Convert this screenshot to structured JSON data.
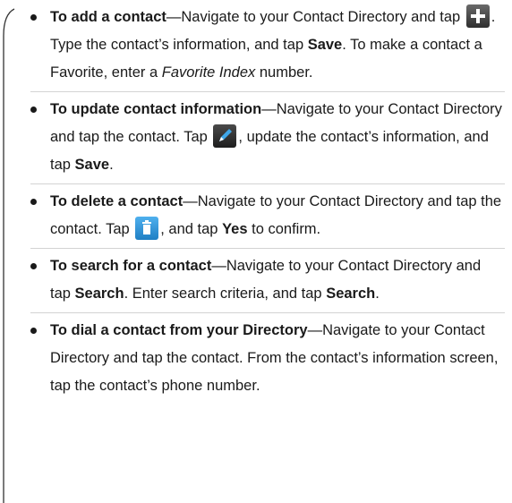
{
  "items": [
    {
      "lead": "To add a contact",
      "dash": "—",
      "pre": "Navigate to your Contact Directory and tap ",
      "icon": "add-icon",
      "mid": ". Type the contact’s information, and tap ",
      "b1": "Save",
      "post": ". To make a contact a Favorite, enter a ",
      "italic": "Favorite Index",
      "end": " number."
    },
    {
      "lead": "To update contact information",
      "dash": "—",
      "pre": "Navigate to your Contact Directory and tap the contact. Tap ",
      "icon": "edit-icon",
      "mid": ", update the contact’s information, and tap ",
      "b1": "Save",
      "end": "."
    },
    {
      "lead": "To delete a contact",
      "dash": "—",
      "pre": "Navigate to your Contact Directory and tap the contact. Tap ",
      "icon": "trash-icon",
      "mid": ", and tap ",
      "b1": "Yes",
      "end": " to confirm."
    },
    {
      "lead": "To search for a contact",
      "dash": "—",
      "pre": "Navigate to your Contact Directory and tap ",
      "b1": "Search",
      "mid": ". Enter search criteria, and tap ",
      "b2": "Search",
      "end": "."
    },
    {
      "lead": "To dial a contact from your Directory",
      "dash": "—",
      "pre": "Navigate to your Contact Directory and tap the contact. From the contact’s information screen, tap the contact’s phone number."
    }
  ],
  "colors": {
    "icon_bg_dark": "#3a3a3a",
    "icon_bg_light": "#6a6a6a",
    "trash_blue": "#2a8fd6",
    "edit_blue": "#3fa6e8"
  }
}
